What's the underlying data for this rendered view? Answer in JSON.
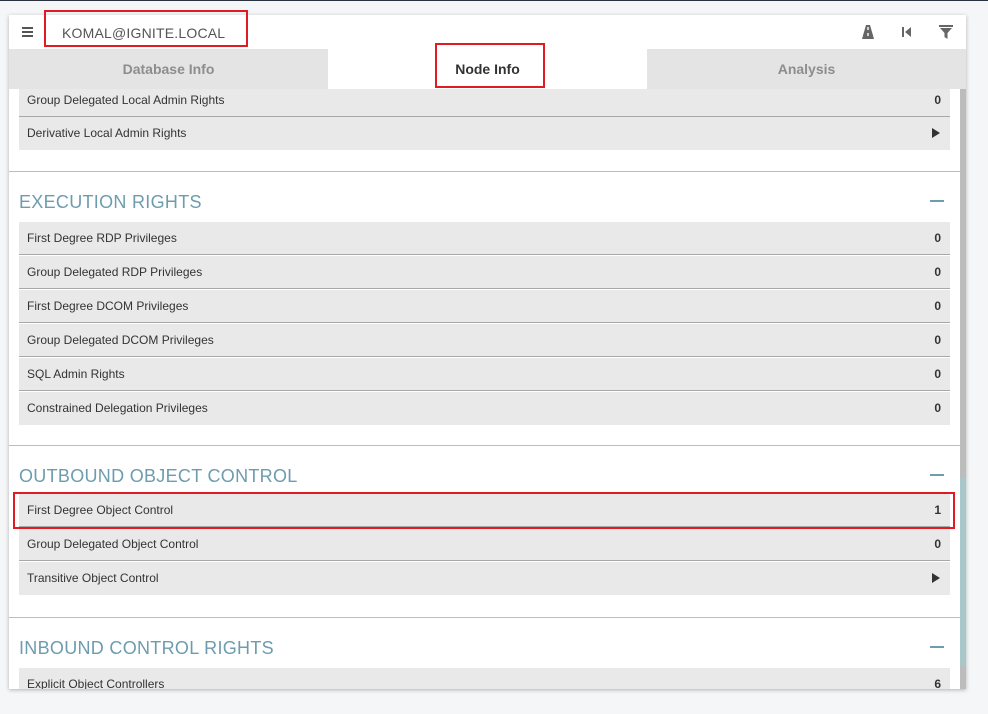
{
  "search": {
    "value": "KOMAL@IGNITE.LOCAL",
    "placeholder": ""
  },
  "header_icons": [
    "pathfinding-icon",
    "back-icon",
    "filter-icon"
  ],
  "tabs": [
    {
      "label": "Database Info"
    },
    {
      "label": "Node Info"
    },
    {
      "label": "Analysis"
    }
  ],
  "active_tab": "Node Info",
  "local_admin": {
    "rows": [
      {
        "label": "Group Delegated Local Admin Rights",
        "value": "0"
      },
      {
        "label": "Derivative Local Admin Rights",
        "value": ""
      }
    ]
  },
  "execution_rights": {
    "title": "EXECUTION RIGHTS",
    "rows": [
      {
        "label": "First Degree RDP Privileges",
        "value": "0"
      },
      {
        "label": "Group Delegated RDP Privileges",
        "value": "0"
      },
      {
        "label": "First Degree DCOM Privileges",
        "value": "0"
      },
      {
        "label": "Group Delegated DCOM Privileges",
        "value": "0"
      },
      {
        "label": "SQL Admin Rights",
        "value": "0"
      },
      {
        "label": "Constrained Delegation Privileges",
        "value": "0"
      }
    ]
  },
  "outbound_control": {
    "title": "OUTBOUND OBJECT CONTROL",
    "rows": [
      {
        "label": "First Degree Object Control",
        "value": "1"
      },
      {
        "label": "Group Delegated Object Control",
        "value": "0"
      },
      {
        "label": "Transitive Object Control",
        "value": ""
      }
    ]
  },
  "inbound_control": {
    "title": "INBOUND CONTROL RIGHTS",
    "rows": [
      {
        "label": "Explicit Object Controllers",
        "value": "6"
      }
    ]
  },
  "colors": {
    "section_title": "#6d9cae",
    "highlight": "#e01b24",
    "row_bg": "#e9e9e9",
    "tab_inactive_bg": "#e4e4e4"
  }
}
